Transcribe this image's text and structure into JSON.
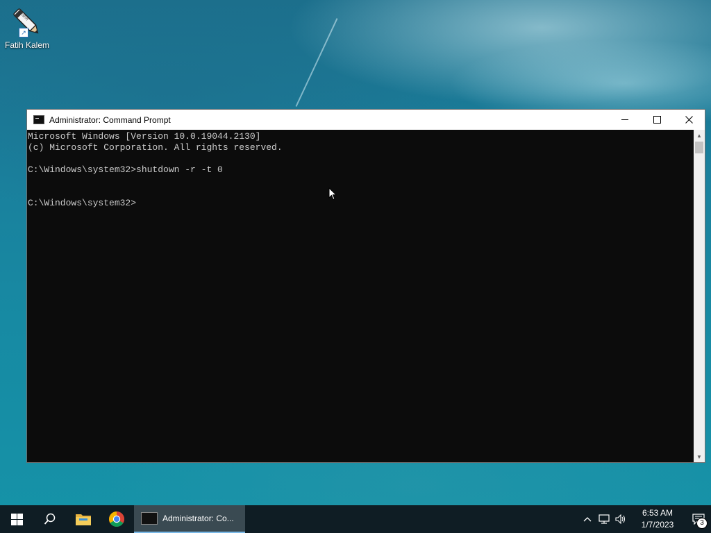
{
  "desktop": {
    "icons": [
      {
        "label": "Fatih Kalem",
        "icon": "pen-icon",
        "badge_text": "fatih"
      }
    ]
  },
  "window": {
    "title": "Administrator:  Command Prompt",
    "controls": {
      "minimize": "─",
      "maximize": "☐",
      "close": "✕"
    },
    "console_lines": [
      "Microsoft Windows [Version 10.0.19044.2130]",
      "(c) Microsoft Corporation. All rights reserved.",
      "",
      "C:\\Windows\\system32>shutdown -r -t 0",
      "",
      "",
      "C:\\Windows\\system32>"
    ]
  },
  "taskbar": {
    "start_icon": "windows-start-icon",
    "search_icon": "search-icon",
    "pinned": [
      "file-explorer-icon",
      "chrome-icon"
    ],
    "active_task": {
      "label": "Administrator:  Co...",
      "icon": "cmd-icon"
    },
    "tray": {
      "icons": [
        "chevron-up-icon",
        "network-icon",
        "volume-icon"
      ],
      "time": "6:53 AM",
      "date": "1/7/2023",
      "notification_count": "3"
    }
  },
  "colors": {
    "console_bg": "#0c0c0c",
    "console_fg": "#cccccc",
    "taskbar_bg": "#0f1d24",
    "accent": "#7ab9e8"
  }
}
